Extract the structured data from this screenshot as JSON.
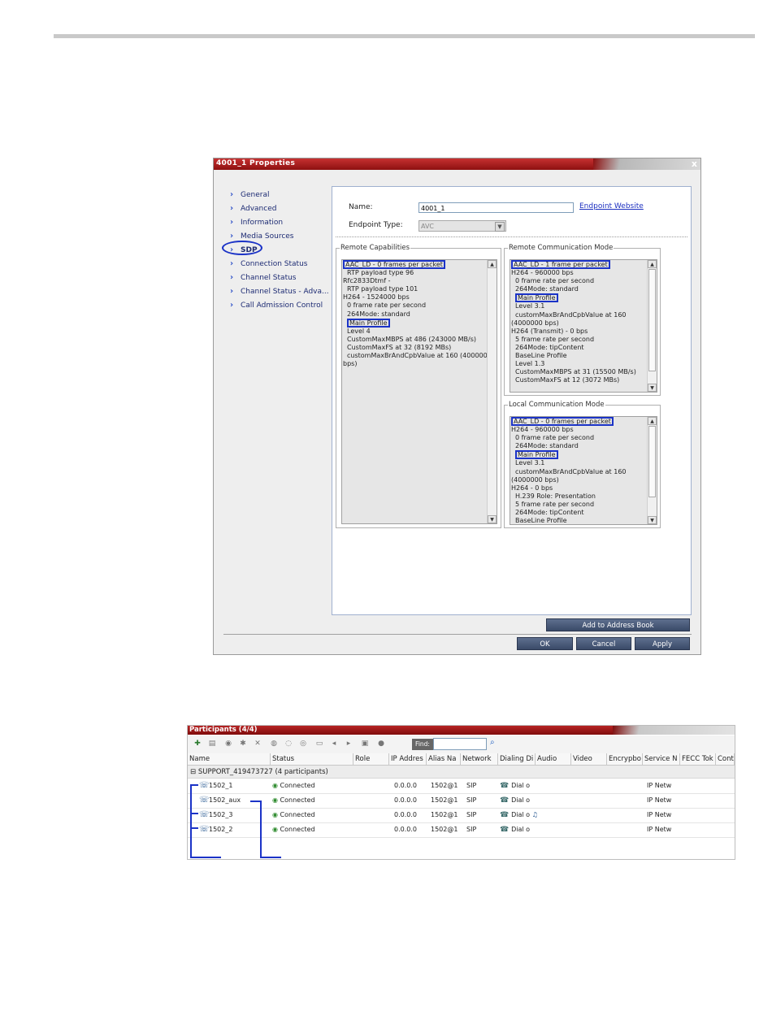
{
  "dialog": {
    "title": "4001_1 Properties",
    "close_glyph": "x",
    "nav_items": [
      {
        "label": "General"
      },
      {
        "label": "Advanced"
      },
      {
        "label": "Information"
      },
      {
        "label": "Media Sources"
      },
      {
        "label": "SDP"
      },
      {
        "label": "Connection Status"
      },
      {
        "label": "Channel Status"
      },
      {
        "label": "Channel Status - Adva..."
      },
      {
        "label": "Call Admission Control"
      }
    ],
    "selected_nav": "SDP",
    "name_label": "Name:",
    "name_value": "4001_1",
    "endpoint_link": "Endpoint Website",
    "endpoint_type_label": "Endpoint Type:",
    "endpoint_type_value": "AVC",
    "remote_capabilities": {
      "legend": "Remote Capabilities",
      "lines": [
        "AAC_LD - 0 frames per packet",
        "RTP payload type 96",
        "Rfc2833Dtmf -",
        "RTP payload type 101",
        "H264 - 1524000 bps",
        "0 frame rate per second",
        "264Mode: standard",
        "Main Profile",
        "Level 4",
        "CustomMaxMBPS at 486 (243000 MB/s)",
        "CustomMaxFS at 32 (8192 MBs)",
        "customMaxBrAndCpbValue at 160 (4000000",
        "bps)"
      ]
    },
    "remote_comm_mode": {
      "legend": "Remote Communication Mode",
      "lines": [
        "AAC_LD - 1 frame per packet",
        "H264 - 960000 bps",
        "0 frame rate per second",
        "264Mode: standard",
        "Main Profile",
        "Level 3.1",
        "customMaxBrAndCpbValue at 160",
        "(4000000 bps)",
        "H264 (Transmit) - 0 bps",
        "5 frame rate per second",
        "264Mode: tipContent",
        "BaseLine Profile",
        "Level 1.3",
        "CustomMaxMBPS at 31 (15500 MB/s)",
        "CustomMaxFS at 12 (3072 MBs)"
      ]
    },
    "local_comm_mode": {
      "legend": "Local Communication Mode",
      "lines": [
        "AAC_LD - 0 frames per packet",
        "H264 - 960000 bps",
        "0 frame rate per second",
        "264Mode: standard",
        "Main Profile",
        "Level 3.1",
        "customMaxBrAndCpbValue at 160",
        "(4000000 bps)",
        "H264 - 0 bps",
        "H.239 Role: Presentation",
        "5 frame rate per second",
        "264Mode: tipContent",
        "BaseLine Profile"
      ]
    },
    "add_to_address_book": "Add to Address Book",
    "ok": "OK",
    "cancel": "Cancel",
    "apply": "Apply"
  },
  "participants": {
    "title": "Participants (4/4)",
    "find_label": "Find:",
    "columns": [
      "Name",
      "Status",
      "Role",
      "IP Addres",
      "Alias Na",
      "Network",
      "Dialing Di",
      "Audio",
      "Video",
      "Encrypbo",
      "Service N",
      "FECC Tok",
      "Cont"
    ],
    "group": "SUPPORT_419473727 (4 participants)",
    "rows": [
      {
        "name": "1502_1",
        "status": "Connected",
        "ip": "0.0.0.0",
        "alias": "1502@1",
        "network": "SIP",
        "dialing": "Dial o",
        "service": "IP Netw"
      },
      {
        "name": "1502_aux",
        "status": "Connected",
        "ip": "0.0.0.0",
        "alias": "1502@1",
        "network": "SIP",
        "dialing": "Dial o",
        "service": "IP Netw"
      },
      {
        "name": "1502_3",
        "status": "Connected",
        "ip": "0.0.0.0",
        "alias": "1502@1",
        "network": "SIP",
        "dialing": "Dial o",
        "service": "IP Netw"
      },
      {
        "name": "1502_2",
        "status": "Connected",
        "ip": "0.0.0.0",
        "alias": "1502@1",
        "network": "SIP",
        "dialing": "Dial o",
        "service": "IP Netw"
      }
    ]
  },
  "colors": {
    "title_red": "#8d1010",
    "highlight_blue": "#1b33c7",
    "link_blue": "#1c2fc0"
  }
}
